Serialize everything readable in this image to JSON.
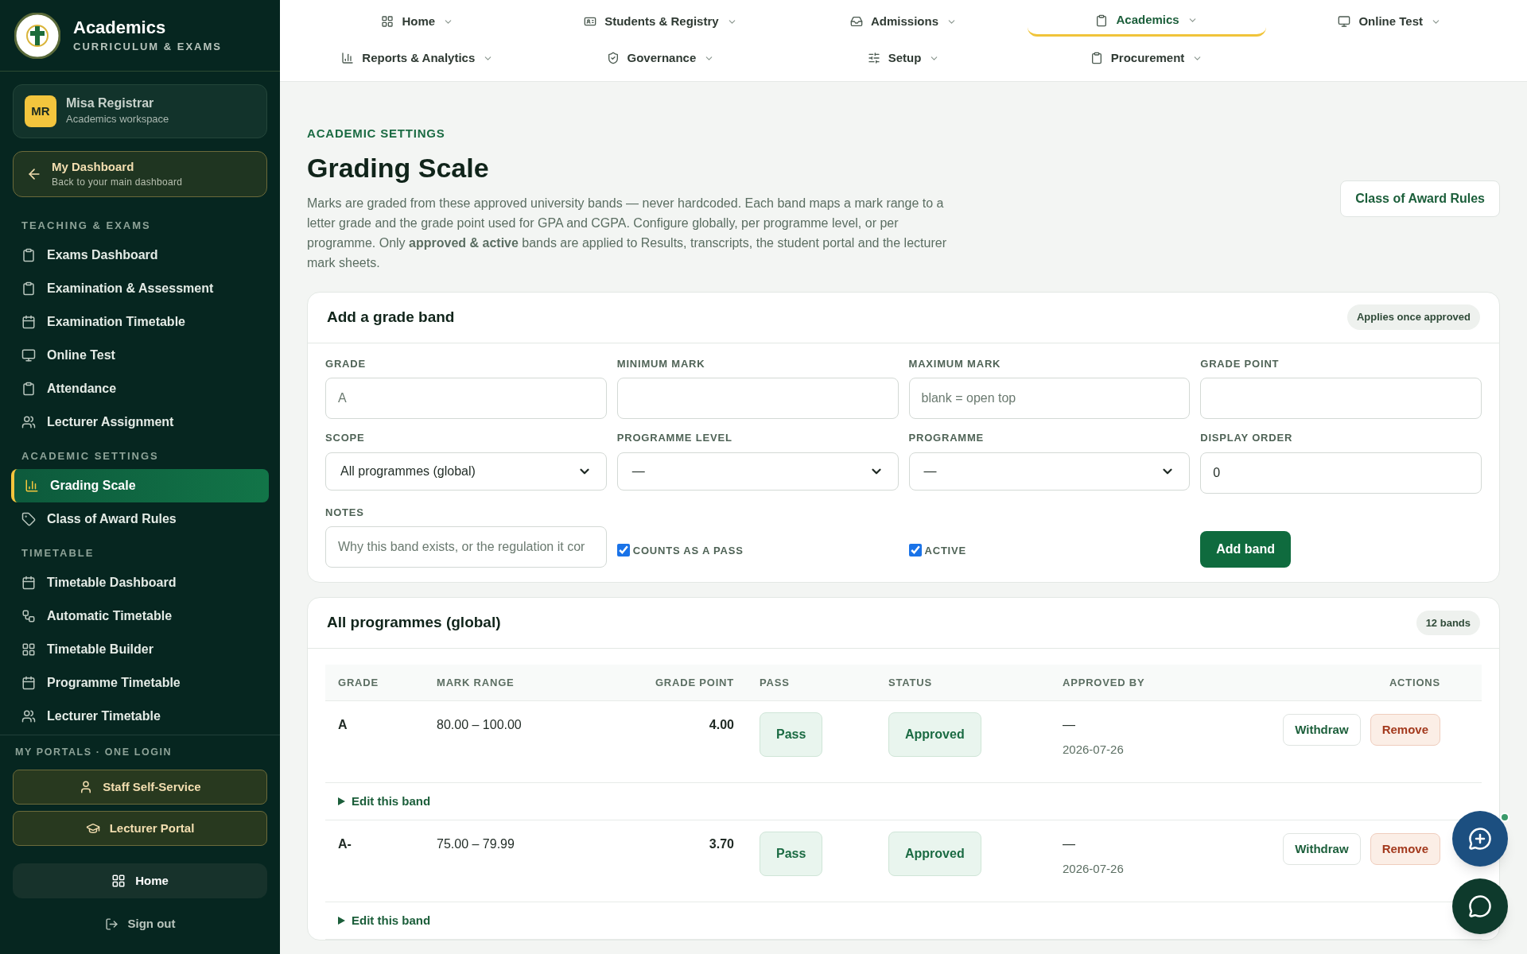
{
  "sidebar": {
    "brand": {
      "title": "Academics",
      "subtitle": "CURRICULUM & EXAMS"
    },
    "user": {
      "initials": "MR",
      "name": "Misa Registrar",
      "role": "Academics workspace"
    },
    "dashboard": {
      "title": "My Dashboard",
      "subtitle": "Back to your main dashboard"
    },
    "sections": [
      {
        "title": "TEACHING & EXAMS",
        "items": [
          {
            "label": "Exams Dashboard",
            "selected": false
          },
          {
            "label": "Examination & Assessment",
            "selected": false
          },
          {
            "label": "Examination Timetable",
            "selected": false
          },
          {
            "label": "Online Test",
            "selected": false
          },
          {
            "label": "Attendance",
            "selected": false
          },
          {
            "label": "Lecturer Assignment",
            "selected": false
          }
        ]
      },
      {
        "title": "ACADEMIC SETTINGS",
        "items": [
          {
            "label": "Grading Scale",
            "selected": true
          },
          {
            "label": "Class of Award Rules",
            "selected": false
          }
        ]
      },
      {
        "title": "TIMETABLE",
        "items": [
          {
            "label": "Timetable Dashboard",
            "selected": false
          },
          {
            "label": "Automatic Timetable",
            "selected": false
          },
          {
            "label": "Timetable Builder",
            "selected": false
          },
          {
            "label": "Programme Timetable",
            "selected": false
          },
          {
            "label": "Lecturer Timetable",
            "selected": false
          }
        ]
      }
    ],
    "portals": {
      "title": "MY PORTALS · ONE LOGIN",
      "buttons": [
        "Staff Self-Service",
        "Lecturer Portal"
      ]
    },
    "home": "Home",
    "sign_out": "Sign out"
  },
  "top_nav": [
    {
      "label": "Home",
      "selected": false
    },
    {
      "label": "Students & Registry",
      "selected": false
    },
    {
      "label": "Admissions",
      "selected": false
    },
    {
      "label": "Academics",
      "selected": true
    },
    {
      "label": "Online Test",
      "selected": false
    },
    {
      "label": "Reports & Analytics",
      "selected": false
    },
    {
      "label": "Governance",
      "selected": false
    },
    {
      "label": "Setup",
      "selected": false
    },
    {
      "label": "Procurement",
      "selected": false
    }
  ],
  "page": {
    "eyebrow": "ACADEMIC SETTINGS",
    "title": "Grading Scale",
    "description": "Marks are graded from these approved university bands — never hardcoded. Each band maps a mark range to a letter grade and the grade point used for GPA and CGPA. Configure globally, per programme level, or per programme. Only **approved & active** bands are applied to Results, transcripts, the student portal and the lecturer mark sheets.",
    "action": "Class of Award Rules"
  },
  "form": {
    "title": "Add a grade band",
    "badge": "Applies once approved",
    "fields": [
      {
        "kind": "input",
        "label": "GRADE",
        "placeholder": "A"
      },
      {
        "kind": "input",
        "label": "MINIMUM MARK"
      },
      {
        "kind": "input",
        "label": "MAXIMUM MARK",
        "placeholder": "blank = open top"
      },
      {
        "kind": "input",
        "label": "GRADE POINT"
      },
      {
        "kind": "select",
        "label": "SCOPE",
        "value": "All programmes (global)"
      },
      {
        "kind": "select",
        "label": "PROGRAMME LEVEL",
        "value": "—"
      },
      {
        "kind": "select",
        "label": "PROGRAMME",
        "value": "—"
      },
      {
        "kind": "input",
        "label": "DISPLAY ORDER",
        "value": "0"
      },
      {
        "kind": "input",
        "label": "NOTES",
        "placeholder": "Why this band exists, or the regulation it cor"
      },
      {
        "kind": "checkbox",
        "label": "COUNTS AS A PASS",
        "checked": true
      },
      {
        "kind": "checkbox",
        "label": "ACTIVE",
        "checked": true
      },
      {
        "kind": "button",
        "label": "Add band"
      }
    ]
  },
  "table": {
    "title": "All programmes (global)",
    "badge": "12 bands",
    "columns": [
      "GRADE",
      "MARK RANGE",
      "GRADE POINT",
      "PASS",
      "STATUS",
      "APPROVED BY",
      "ACTIONS"
    ],
    "rows": [
      {
        "grade": "A",
        "range": "80.00 – 100.00",
        "point": "4.00",
        "pass": "Pass",
        "status": "Approved",
        "approved_by": "—",
        "date": "2026-07-26",
        "actions": [
          {
            "label": "Withdraw",
            "kind": "neutral"
          },
          {
            "label": "Remove",
            "kind": "danger"
          }
        ],
        "edit": "Edit this band"
      },
      {
        "grade": "A-",
        "range": "75.00 – 79.99",
        "point": "3.70",
        "pass": "Pass",
        "status": "Approved",
        "approved_by": "—",
        "date": "2026-07-26",
        "actions": [
          {
            "label": "Withdraw",
            "kind": "neutral"
          },
          {
            "label": "Remove",
            "kind": "danger"
          }
        ],
        "edit": "Edit this band"
      }
    ]
  }
}
